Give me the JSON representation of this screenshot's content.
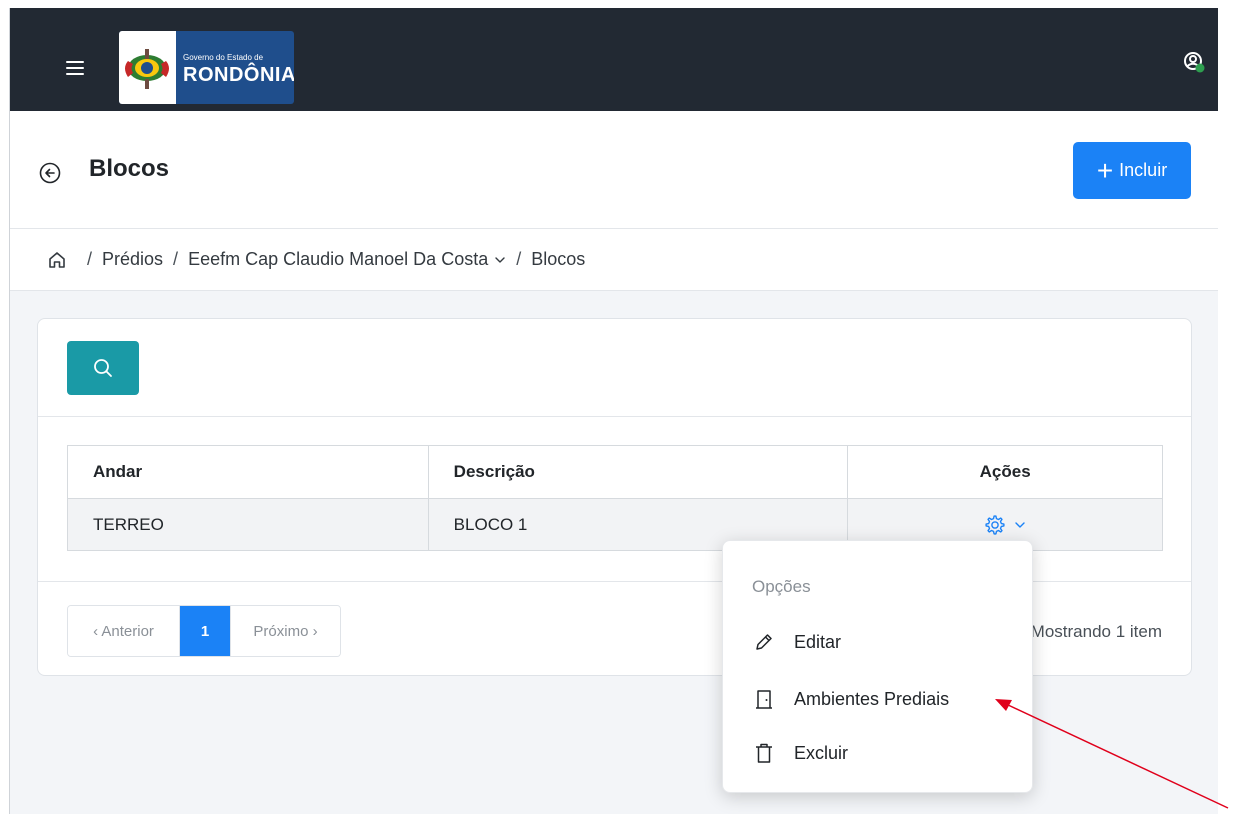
{
  "header": {
    "logo_small": "Governo do Estado de",
    "logo_big": "RONDÔNIA"
  },
  "page": {
    "title": "Blocos",
    "include_label": "Incluir"
  },
  "breadcrumb": {
    "sep": "/",
    "item1": "Prédios",
    "item2": "Eeefm Cap Claudio Manoel Da Costa",
    "item3": "Blocos"
  },
  "table": {
    "headers": [
      "Andar",
      "Descrição",
      "Ações"
    ],
    "rows": [
      {
        "andar": "TERREO",
        "descricao": "BLOCO 1"
      }
    ]
  },
  "pagination": {
    "prev": "‹ Anterior",
    "current": "1",
    "next": "Próximo ›",
    "showing": "Mostrando 1 item"
  },
  "menu": {
    "header": "Opções",
    "edit": "Editar",
    "ambientes": "Ambientes Prediais",
    "delete": "Excluir"
  },
  "colors": {
    "topbar": "#222933",
    "primary": "#1b82f6",
    "search": "#1a9aa6",
    "arrow": "#e0001b"
  }
}
